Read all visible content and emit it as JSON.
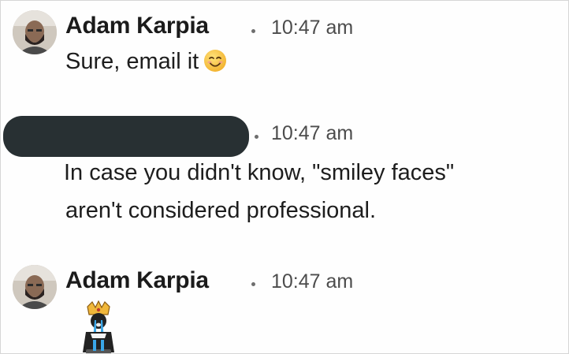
{
  "messages": [
    {
      "sender": "Adam Karpia",
      "time": "10:47 am",
      "text": "Sure, email it",
      "emoji": "smiling-face-emoji"
    },
    {
      "sender": "",
      "sender_redacted": true,
      "time": "10:47 am",
      "text_lines": [
        "In case you didn't know, \"smiley faces\"",
        "aren't considered professional."
      ]
    },
    {
      "sender": "Adam Karpia",
      "time": "10:47 am",
      "emoji": "crying-king-emoji"
    }
  ],
  "colors": {
    "redaction_bar": "#283033",
    "smiley_face": "#f6c443",
    "king_body": "#222222",
    "king_crown": "#f0b73a",
    "king_tears": "#3aa7e8"
  }
}
